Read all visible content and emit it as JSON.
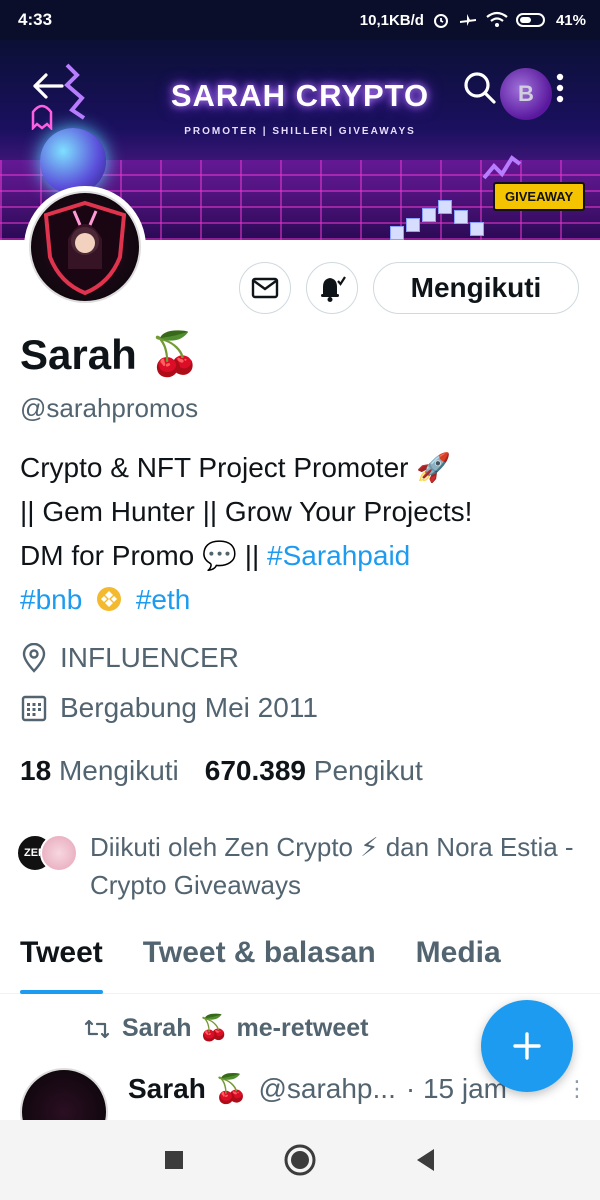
{
  "status_bar": {
    "time": "4:33",
    "network_speed": "10,1KB/d",
    "battery": "41%"
  },
  "banner": {
    "title": "SARAH CRYPTO",
    "subtitle": "PROMOTER | SHILLER| GIVEAWAYS",
    "badge": "GIVEAWAY",
    "coin_symbol": "B"
  },
  "profile": {
    "name": "Sarah",
    "name_emoji": "🍒",
    "handle": "@sarahpromos",
    "follow_button": "Mengikuti",
    "bio": {
      "line1_text": "Crypto & NFT Project Promoter",
      "line1_emoji": "🚀",
      "line2_text": "|| Gem Hunter || Grow Your Projects!",
      "line3_text": "DM for Promo",
      "line3_emoji": "💬",
      "line3_sep": "||",
      "hashtag1": "#Sarahpaid",
      "hashtag2": "#bnb",
      "hashtag3": "#eth"
    },
    "location": "INFLUENCER",
    "joined": "Bergabung Mei 2011",
    "following_count": "18",
    "following_label": "Mengikuti",
    "followers_count": "670.389",
    "followers_label": "Pengikut",
    "followed_by": "Diikuti oleh Zen Crypto ⚡ dan Nora Estia - Crypto Giveaways",
    "followed_by_avatar_text": "ZEN"
  },
  "tabs": [
    {
      "label": "Tweet"
    },
    {
      "label": "Tweet & balasan"
    },
    {
      "label": "Media"
    }
  ],
  "tweet": {
    "retweet_text": "Sarah 🍒 me-retweet",
    "name": "Sarah 🍒",
    "handle": "@sarahp...",
    "time": "· 15 jam"
  },
  "icons": {
    "back": "arrow-left-icon",
    "search": "search-icon",
    "more": "more-vertical-icon",
    "mail": "mail-icon",
    "bell": "bell-icon",
    "location": "location-pin-icon",
    "calendar": "calendar-icon",
    "retweet": "retweet-icon",
    "compose": "plus-icon"
  },
  "colors": {
    "accent": "#1d9bf0",
    "text_primary": "#0f1419",
    "text_secondary": "#536471",
    "badge_yellow": "#f5c400"
  }
}
